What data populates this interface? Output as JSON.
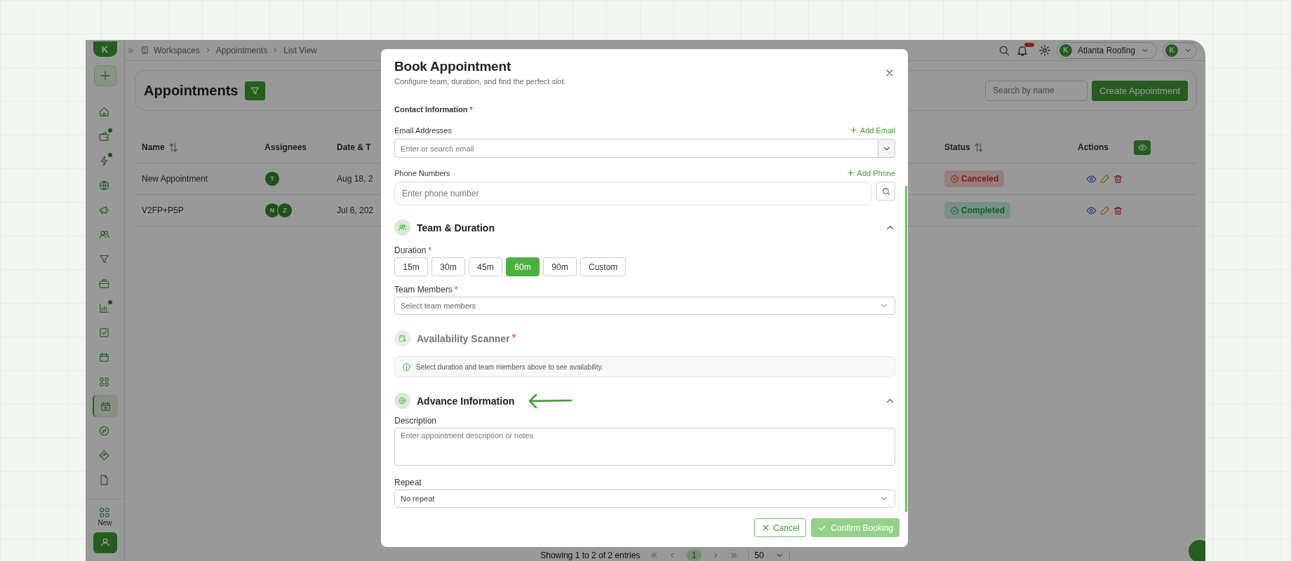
{
  "topbar": {
    "logo": "K",
    "breadcrumbs": [
      "Workspaces",
      "Appointments",
      "List View"
    ],
    "org": {
      "avatar": "K",
      "name": "Atlanta Roofing"
    },
    "user": {
      "avatar": "K"
    }
  },
  "sidebar": {
    "items": [
      {
        "kind": "home",
        "dot": false,
        "selected": false
      },
      {
        "kind": "wallet",
        "dot": true,
        "selected": false
      },
      {
        "kind": "bolt",
        "dot": true,
        "selected": false
      },
      {
        "kind": "globe",
        "dot": false,
        "selected": false
      },
      {
        "kind": "megaphone",
        "dot": false,
        "selected": false
      },
      {
        "kind": "users",
        "dot": false,
        "selected": false
      },
      {
        "kind": "filter",
        "dot": false,
        "selected": false
      },
      {
        "kind": "briefcase",
        "dot": false,
        "selected": false
      },
      {
        "kind": "chart",
        "dot": true,
        "selected": false
      },
      {
        "kind": "check",
        "dot": false,
        "selected": false
      },
      {
        "kind": "calendar",
        "dot": false,
        "selected": false
      },
      {
        "kind": "grid",
        "dot": false,
        "selected": false
      },
      {
        "kind": "calendar-plus",
        "dot": false,
        "selected": true
      },
      {
        "kind": "compass",
        "dot": false,
        "selected": false
      },
      {
        "kind": "route",
        "dot": false,
        "selected": false
      },
      {
        "kind": "file",
        "dot": false,
        "selected": false
      }
    ],
    "new_label": "New"
  },
  "header": {
    "title": "Appointments",
    "search_placeholder": "Search by name",
    "create_button": "Create Appointment"
  },
  "table": {
    "columns": [
      {
        "label": "Name",
        "sortable": true
      },
      {
        "label": "Assignees",
        "sortable": false
      },
      {
        "label": "Date & T",
        "sortable": false
      },
      {
        "label": "Status",
        "sortable": true
      },
      {
        "label": "Actions",
        "sortable": false
      }
    ],
    "rows": [
      {
        "name": "New Appointment",
        "assignees": [
          "T"
        ],
        "date": "Aug 18, 2",
        "status": {
          "label": "Canceled",
          "kind": "canceled"
        }
      },
      {
        "name": "V2FP+P5P",
        "assignees": [
          "N",
          "Z"
        ],
        "date": "Jul 6, 202",
        "status": {
          "label": "Completed",
          "kind": "completed"
        }
      }
    ]
  },
  "pagination": {
    "summary": "Showing 1 to 2 of 2 entries",
    "pages": [
      {
        "label": "1",
        "selected": true
      }
    ],
    "per_page": "50"
  },
  "modal": {
    "title": "Book Appointment",
    "subtitle": "Configure team, duration, and find the perfect slot.",
    "contact": {
      "label": "Contact Information",
      "required_mark": "*",
      "email": {
        "label": "Email Addresses",
        "add_label": "Add Email",
        "placeholder": "Enter or search email"
      },
      "phone": {
        "label": "Phone Numbers",
        "add_label": "Add Phone",
        "placeholder": "Enter phone number"
      }
    },
    "team_duration": {
      "title": "Team & Duration",
      "expanded": true,
      "duration": {
        "label": "Duration",
        "required_mark": "*",
        "options": [
          {
            "label": "15m",
            "selected": false
          },
          {
            "label": "30m",
            "selected": false
          },
          {
            "label": "45m",
            "selected": false
          },
          {
            "label": "60m",
            "selected": true
          },
          {
            "label": "90m",
            "selected": false
          },
          {
            "label": "Custom",
            "selected": false
          }
        ]
      },
      "team_members": {
        "label": "Team Members",
        "required_mark": "*",
        "placeholder": "Select team members"
      }
    },
    "availability": {
      "title": "Availability Scanner",
      "required_mark": "*",
      "disabled": true,
      "message": "Select duration and team members above to see availability."
    },
    "advance": {
      "title": "Advance Information",
      "expanded": true,
      "description": {
        "label": "Description",
        "placeholder": "Enter appointment description or notes"
      },
      "repeat": {
        "label": "Repeat",
        "value": "No repeat"
      }
    },
    "footer": {
      "cancel": "Cancel",
      "confirm": {
        "label": "Confirm Booking",
        "disabled": true
      }
    }
  }
}
